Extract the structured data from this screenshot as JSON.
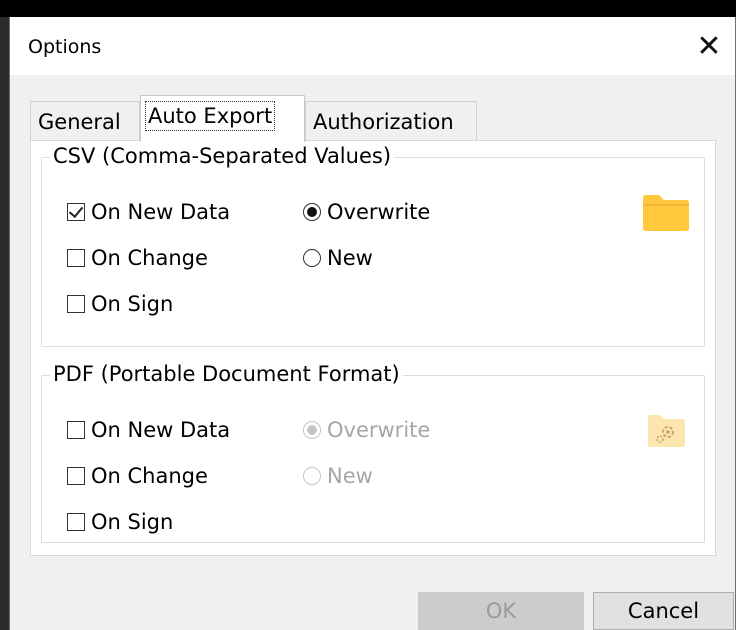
{
  "window": {
    "title": "Options"
  },
  "tabs": [
    {
      "label": "General"
    },
    {
      "label": "Auto Export"
    },
    {
      "label": "Authorization"
    }
  ],
  "active_tab": "Auto Export",
  "csv": {
    "legend": "CSV (Comma-Separated Values)",
    "on_new_data": {
      "label": "On New Data",
      "checked": true
    },
    "on_change": {
      "label": "On Change",
      "checked": false
    },
    "on_sign": {
      "label": "On Sign",
      "checked": false
    },
    "overwrite": {
      "label": "Overwrite",
      "selected": true
    },
    "new": {
      "label": "New",
      "selected": false
    },
    "folder_icon": "folder-icon"
  },
  "pdf": {
    "legend": "PDF (Portable Document Format)",
    "on_new_data": {
      "label": "On New Data",
      "checked": false
    },
    "on_change": {
      "label": "On Change",
      "checked": false
    },
    "on_sign": {
      "label": "On Sign",
      "checked": false
    },
    "overwrite": {
      "label": "Overwrite",
      "selected": true,
      "disabled": true
    },
    "new": {
      "label": "New",
      "selected": false,
      "disabled": true
    },
    "folder_icon": "folder-settings-icon"
  },
  "buttons": {
    "ok": "OK",
    "cancel": "Cancel"
  },
  "colors": {
    "folder": "#FFC83D",
    "folder_disabled": "#FCE6B0",
    "disabled_text": "#A6A6A6"
  }
}
